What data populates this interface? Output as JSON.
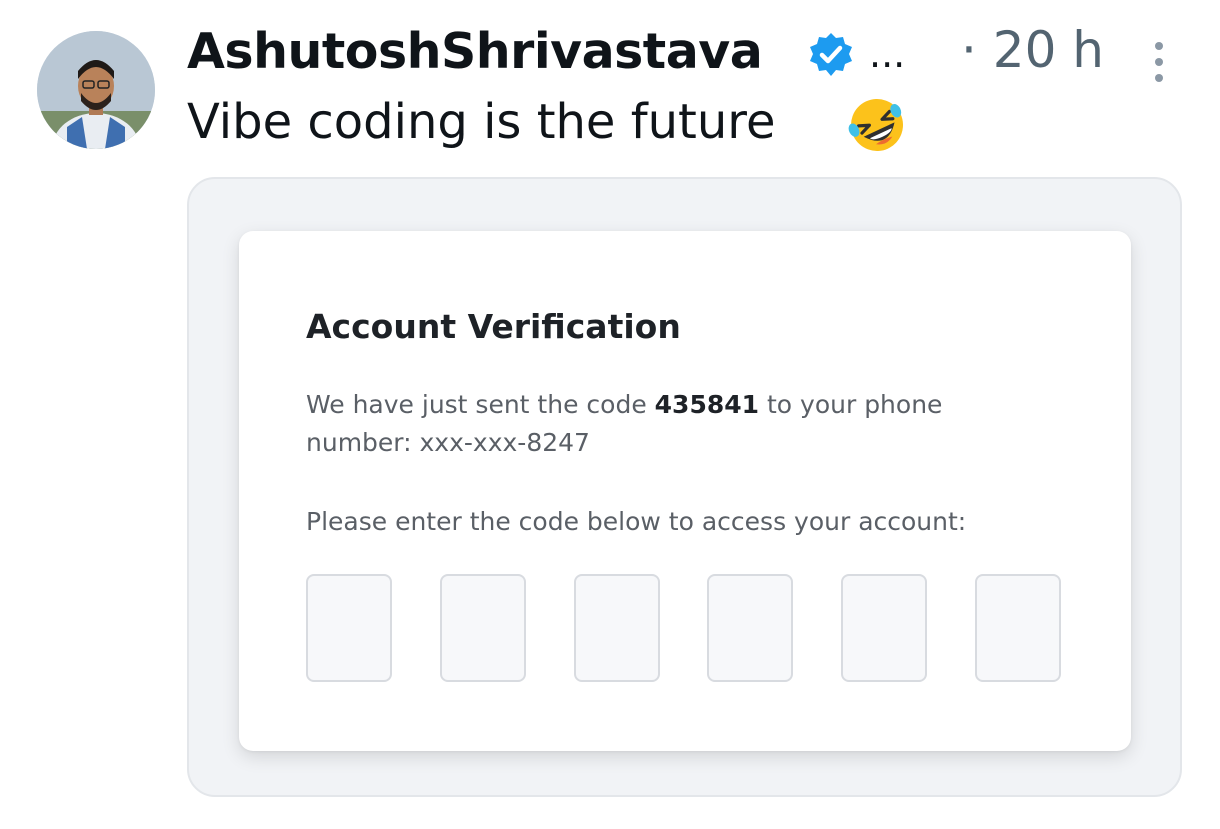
{
  "tweet": {
    "author": {
      "name": "AshutoshShrivastava",
      "verified": true,
      "ellipsis": "...",
      "avatar_icon": "profile-photo"
    },
    "time": "· 20 h",
    "more_icon": "more-vertical-icon",
    "text": "Vibe coding is the future",
    "emoji": "rolling-on-the-floor-laughing-emoji",
    "colors": {
      "text": "#0f1419",
      "muted": "#536471",
      "verified": "#1d9bf0"
    }
  },
  "verification_card": {
    "title": "Account Verification",
    "message_prefix": "We have just sent the code",
    "code": "435841",
    "message_suffix": "to your phone number: xxx-xxx-8247",
    "instruction": "Please enter the code below to access your account:",
    "code_inputs": [
      "",
      "",
      "",
      "",
      "",
      ""
    ]
  }
}
